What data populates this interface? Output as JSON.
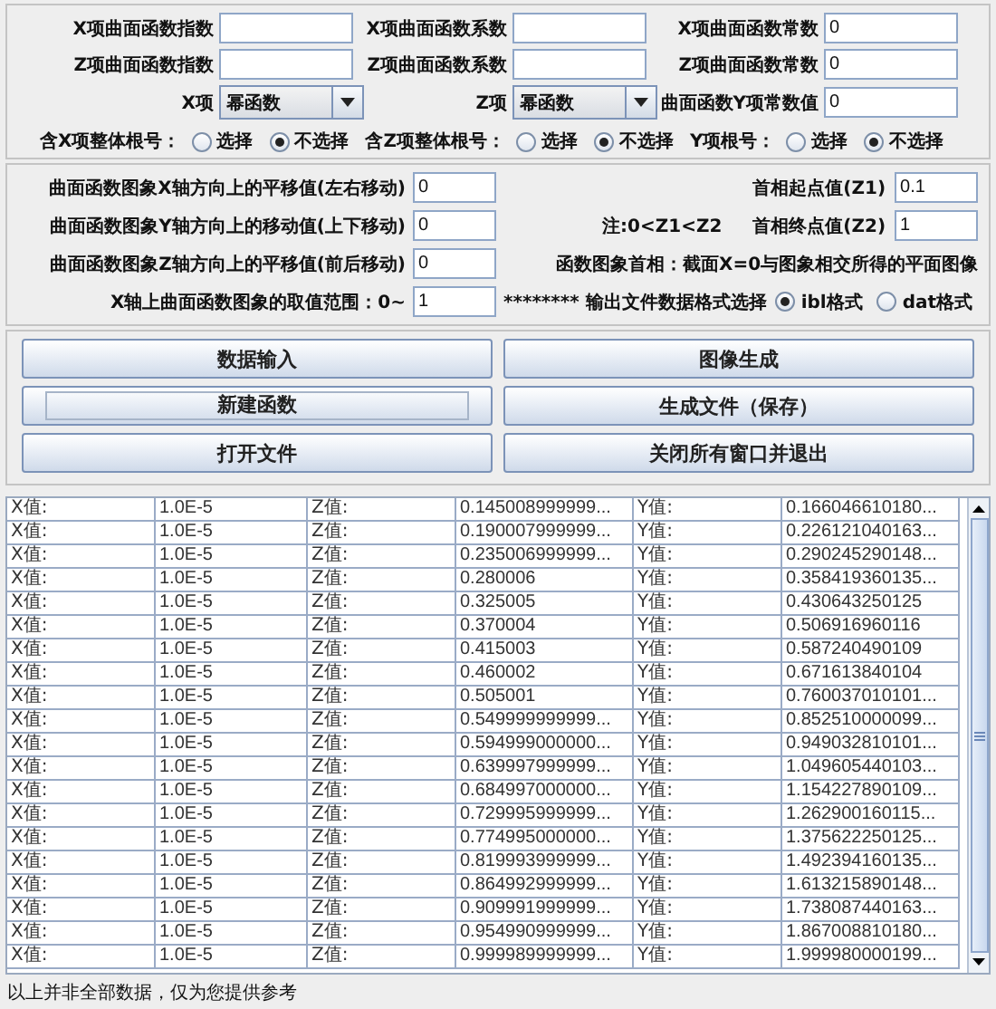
{
  "coefficient_rows": [
    [
      {
        "label": "X项曲面函数指数"
      },
      {
        "label": "X项曲面函数系数"
      },
      {
        "label": "X项曲面函数常数",
        "value": "0"
      }
    ],
    [
      {
        "label": "Z项曲面函数指数"
      },
      {
        "label": "Z项曲面函数系数"
      },
      {
        "label": "Z项曲面函数常数",
        "value": "0"
      }
    ]
  ],
  "selectors": [
    {
      "label": "X项",
      "value": "幂函数"
    },
    {
      "label": "Z项",
      "value": "幂函数"
    }
  ],
  "y_constant": {
    "label": "曲面函数Y项常数值",
    "value": "0"
  },
  "root_options": [
    {
      "label": "含X项整体根号：",
      "options": [
        {
          "label": "选择",
          "selected": false
        },
        {
          "label": "不选择",
          "selected": true
        }
      ]
    },
    {
      "label": "含Z项整体根号：",
      "options": [
        {
          "label": "选择",
          "selected": false
        },
        {
          "label": "不选择",
          "selected": true
        }
      ]
    },
    {
      "label": "Y项根号：",
      "options": [
        {
          "label": "选择",
          "selected": false
        },
        {
          "label": "不选择",
          "selected": true
        }
      ]
    }
  ],
  "shift_fields": [
    {
      "label": "曲面函数图象X轴方向上的平移值(左右移动)",
      "value": "0"
    },
    {
      "label": "曲面函数图象Y轴方向上的移动值(上下移动)",
      "value": "0"
    },
    {
      "label": "曲面函数图象Z轴方向上的平移值(前后移动)",
      "value": "0"
    }
  ],
  "range_field": {
    "label": "X轴上曲面函数图象的取值范围：0~",
    "value": "1"
  },
  "z1_field": {
    "label": "首相起点值(Z1)",
    "value": "0.1"
  },
  "note": "注:0<Z1<Z2",
  "z2_field": {
    "label": "首相终点值(Z2)",
    "value": "1"
  },
  "first_phase_note": "函数图象首相：截面X=0与图象相交所得的平面图像",
  "format_label": "******** 输出文件数据格式选择",
  "format_options": [
    {
      "label": "ibl格式",
      "selected": true
    },
    {
      "label": "dat格式",
      "selected": false
    }
  ],
  "buttons": [
    {
      "label": "数据输入",
      "focused": false
    },
    {
      "label": "图像生成",
      "focused": false
    },
    {
      "label": "新建函数",
      "focused": true
    },
    {
      "label": "生成文件（保存）",
      "focused": false
    },
    {
      "label": "打开文件",
      "focused": false
    },
    {
      "label": "关闭所有窗口并退出",
      "focused": false
    }
  ],
  "table": {
    "rows": [
      [
        "X值:",
        "1.0E-5",
        "Z值:",
        "0.145008999999...",
        "Y值:",
        "0.166046610180..."
      ],
      [
        "X值:",
        "1.0E-5",
        "Z值:",
        "0.190007999999...",
        "Y值:",
        "0.226121040163..."
      ],
      [
        "X值:",
        "1.0E-5",
        "Z值:",
        "0.235006999999...",
        "Y值:",
        "0.290245290148..."
      ],
      [
        "X值:",
        "1.0E-5",
        "Z值:",
        "0.280006",
        "Y值:",
        "0.358419360135..."
      ],
      [
        "X值:",
        "1.0E-5",
        "Z值:",
        "0.325005",
        "Y值:",
        "0.430643250125"
      ],
      [
        "X值:",
        "1.0E-5",
        "Z值:",
        "0.370004",
        "Y值:",
        "0.506916960116"
      ],
      [
        "X值:",
        "1.0E-5",
        "Z值:",
        "0.415003",
        "Y值:",
        "0.587240490109"
      ],
      [
        "X值:",
        "1.0E-5",
        "Z值:",
        "0.460002",
        "Y值:",
        "0.671613840104"
      ],
      [
        "X值:",
        "1.0E-5",
        "Z值:",
        "0.505001",
        "Y值:",
        "0.760037010101..."
      ],
      [
        "X值:",
        "1.0E-5",
        "Z值:",
        "0.549999999999...",
        "Y值:",
        "0.852510000099..."
      ],
      [
        "X值:",
        "1.0E-5",
        "Z值:",
        "0.594999000000...",
        "Y值:",
        "0.949032810101..."
      ],
      [
        "X值:",
        "1.0E-5",
        "Z值:",
        "0.639997999999...",
        "Y值:",
        "1.049605440103..."
      ],
      [
        "X值:",
        "1.0E-5",
        "Z值:",
        "0.684997000000...",
        "Y值:",
        "1.154227890109..."
      ],
      [
        "X值:",
        "1.0E-5",
        "Z值:",
        "0.729995999999...",
        "Y值:",
        "1.262900160115..."
      ],
      [
        "X值:",
        "1.0E-5",
        "Z值:",
        "0.774995000000...",
        "Y值:",
        "1.375622250125..."
      ],
      [
        "X值:",
        "1.0E-5",
        "Z值:",
        "0.819993999999...",
        "Y值:",
        "1.492394160135..."
      ],
      [
        "X值:",
        "1.0E-5",
        "Z值:",
        "0.864992999999...",
        "Y值:",
        "1.613215890148..."
      ],
      [
        "X值:",
        "1.0E-5",
        "Z值:",
        "0.909991999999...",
        "Y值:",
        "1.738087440163..."
      ],
      [
        "X值:",
        "1.0E-5",
        "Z值:",
        "0.954990999999...",
        "Y值:",
        "1.867008810180..."
      ],
      [
        "X值:",
        "1.0E-5",
        "Z值:",
        "0.999989999999...",
        "Y值:",
        "1.999980000199..."
      ]
    ]
  },
  "footer": "以上并非全部数据，仅为您提供参考"
}
